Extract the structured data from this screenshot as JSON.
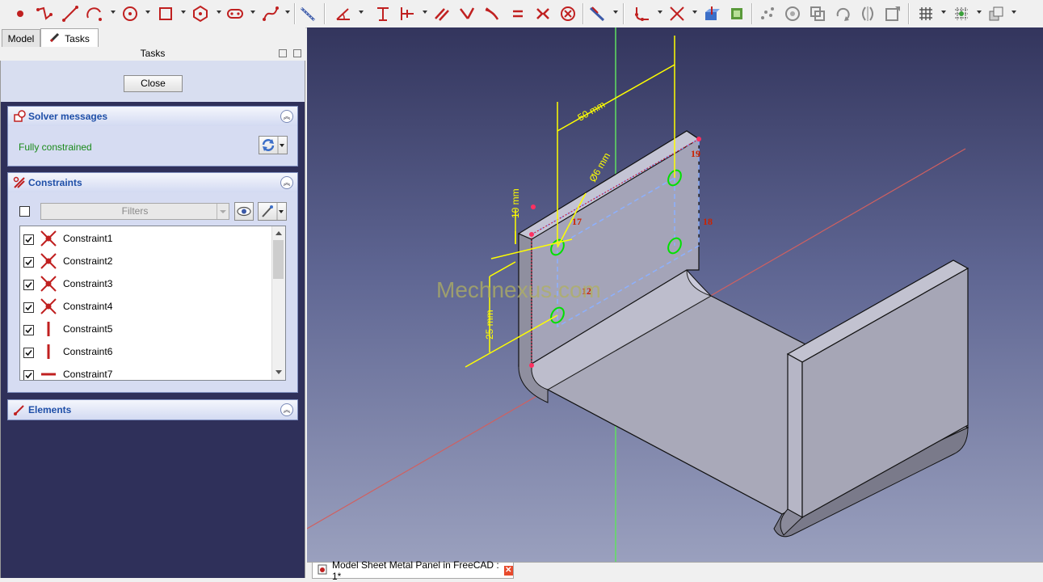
{
  "toolbar": {
    "icons": [
      "point-icon",
      "polyline-icon",
      "line-icon",
      "arc-icon",
      "circle-icon",
      "rectangle-icon",
      "polygon-icon",
      "slot-icon",
      "bspline-icon",
      "external-geometry-icon",
      "constrain-angle-icon",
      "constrain-vertical-distance-icon",
      "constrain-horizontal-distance-icon",
      "constrain-parallel-icon",
      "constrain-perpendicular-icon",
      "constrain-tangent-icon",
      "constrain-equal-icon",
      "constrain-symmetric-icon",
      "constrain-block-icon",
      "toggle-driving-icon",
      "fillet-icon",
      "trim-icon",
      "extend-icon",
      "external-icon",
      "carbon-copy-icon",
      "select-constraints-icon",
      "close-shape-icon",
      "clone-icon",
      "rotate-icon",
      "symmetry-icon",
      "array-icon",
      "grid-icon",
      "snap-icon",
      "rendering-order-icon"
    ]
  },
  "tabs": {
    "model": "Model",
    "tasks": "Tasks"
  },
  "tasks_header": "Tasks",
  "close_button": "Close",
  "solver": {
    "title": "Solver messages",
    "status": "Fully constrained",
    "status_color": "#1a8a1a"
  },
  "constraints": {
    "title": "Constraints",
    "filter_placeholder": "Filters",
    "items": [
      {
        "label": "Constraint1",
        "icon": "coincident-icon"
      },
      {
        "label": "Constraint2",
        "icon": "coincident-icon"
      },
      {
        "label": "Constraint3",
        "icon": "coincident-icon"
      },
      {
        "label": "Constraint4",
        "icon": "coincident-icon"
      },
      {
        "label": "Constraint5",
        "icon": "vertical-icon"
      },
      {
        "label": "Constraint6",
        "icon": "vertical-icon"
      },
      {
        "label": "Constraint7",
        "icon": "horizontal-icon"
      }
    ]
  },
  "elements": {
    "title": "Elements"
  },
  "viewport": {
    "watermark": "Mechnexus.com",
    "dimensions": {
      "width": "50 mm",
      "diameter": "Ø6 mm",
      "top_offset": "10 mm",
      "hole_spacing": "25 mm"
    },
    "constraint_labels": {
      "c17": "17",
      "c19": "19",
      "c18": "18",
      "c12": "12"
    },
    "colors": {
      "dimension": "#ffff00",
      "sketch_lines": "#8cb0ff",
      "hole": "#00e000",
      "constraint_text": "#cc2200",
      "x_axis": "#d06060",
      "y_axis": "#60e060",
      "part": "#a9a9b9"
    }
  },
  "document_tab": {
    "label": "Model Sheet Metal Panel in FreeCAD : 1*"
  }
}
